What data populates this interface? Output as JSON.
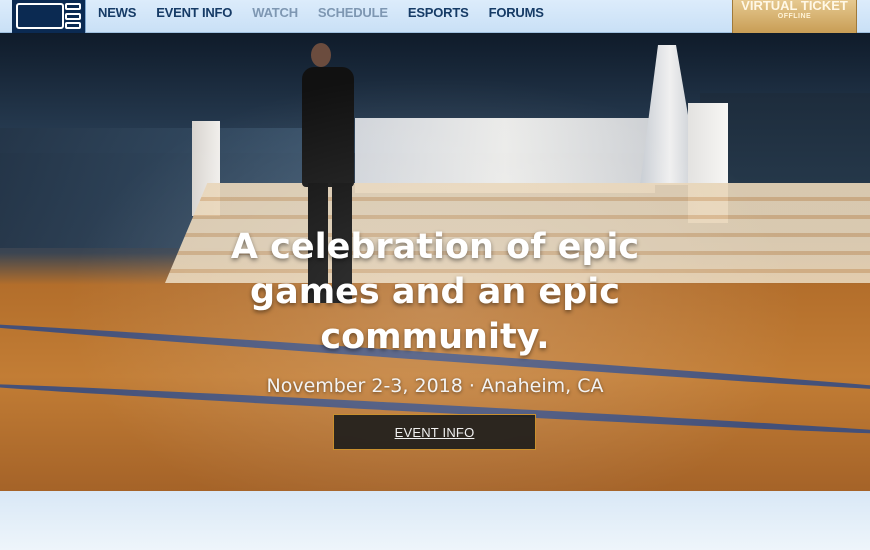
{
  "header": {
    "logo_text": "BLIZZCON",
    "nav": [
      {
        "label": "NEWS",
        "state": "active"
      },
      {
        "label": "EVENT INFO",
        "state": "active"
      },
      {
        "label": "WATCH",
        "state": "dim"
      },
      {
        "label": "SCHEDULE",
        "state": "dim"
      },
      {
        "label": "ESPORTS",
        "state": "active"
      },
      {
        "label": "FORUMS",
        "state": "active"
      }
    ],
    "virtual_ticket": {
      "label": "VIRTUAL TICKET",
      "status": "OFFLINE"
    }
  },
  "hero": {
    "title": "A celebration of epic games and an epic community.",
    "subtitle": "November 2-3, 2018 · Anaheim, CA",
    "cta_label": "EVENT INFO"
  },
  "colors": {
    "nav_bg": "#c9e0f6",
    "nav_text": "#163b66",
    "nav_dim_text": "#7e97b2",
    "ticket_gold": "#c89d55",
    "cta_border": "#c98f2e"
  }
}
